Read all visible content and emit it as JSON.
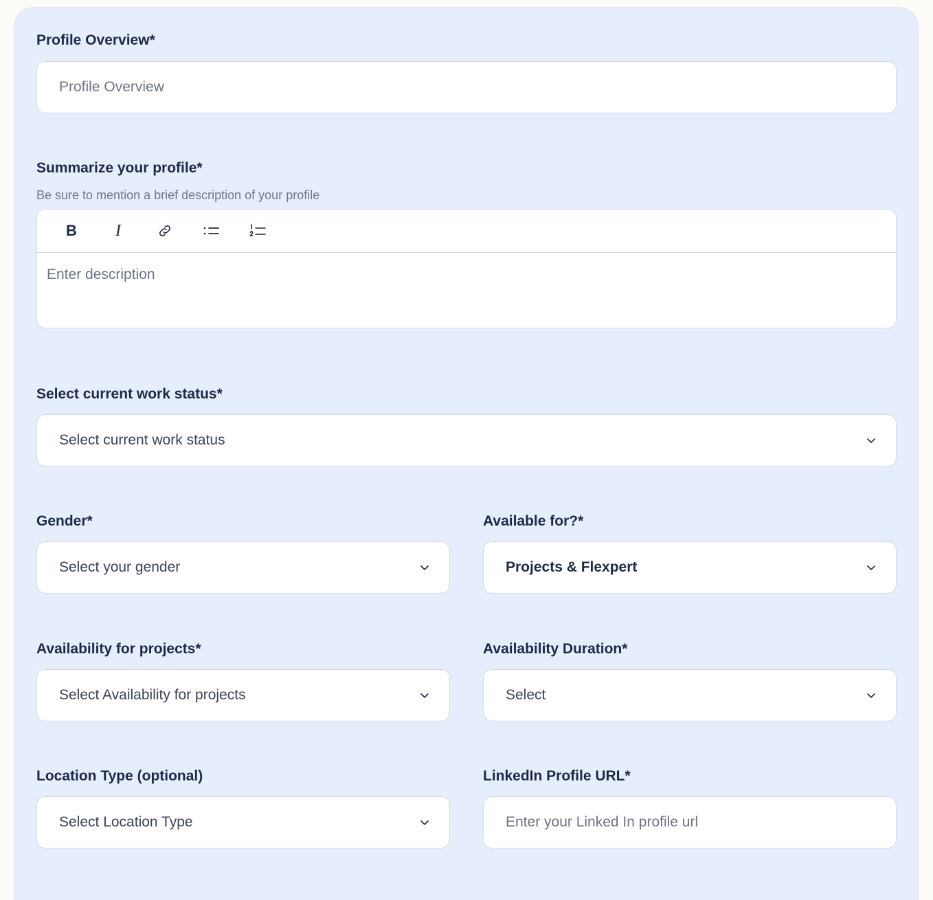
{
  "profile_overview": {
    "label": "Profile Overview*",
    "placeholder": "Profile Overview"
  },
  "summary": {
    "label": "Summarize your profile*",
    "hint": "Be sure to mention a brief description of your profile",
    "toolbar": {
      "bold": "B",
      "italic": "I",
      "icons": [
        "link-icon",
        "bullet-list-icon",
        "numbered-list-icon"
      ]
    },
    "placeholder": "Enter description"
  },
  "work_status": {
    "label": "Select current work status*",
    "value": "Select current work status"
  },
  "gender": {
    "label": "Gender*",
    "value": "Select your gender"
  },
  "available_for": {
    "label": "Available for?*",
    "value": "Projects & Flexpert"
  },
  "availability_projects": {
    "label": "Availability for projects*",
    "value": "Select Availability for projects"
  },
  "availability_duration": {
    "label": "Availability Duration*",
    "value": "Select"
  },
  "location_type": {
    "label": "Location Type (optional)",
    "value": "Select Location Type"
  },
  "linkedin": {
    "label": "LinkedIn Profile URL*",
    "placeholder": "Enter your Linked In profile url"
  },
  "colors": {
    "card_background": "#e6eefd",
    "label_text": "#1e2945",
    "field_border": "#d5dbe6"
  }
}
